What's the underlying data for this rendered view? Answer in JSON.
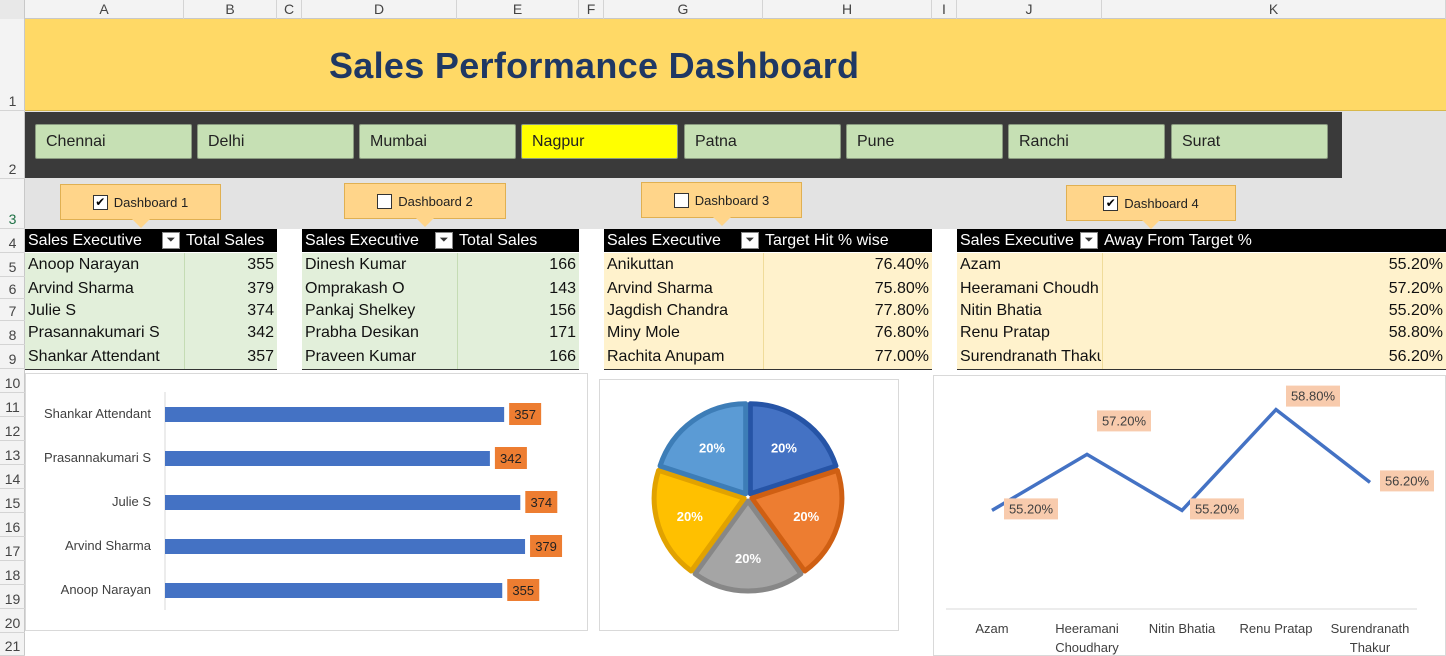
{
  "columns": [
    "A",
    "B",
    "C",
    "D",
    "E",
    "F",
    "G",
    "H",
    "I",
    "J",
    "K"
  ],
  "rows": [
    "1",
    "2",
    "3",
    "4",
    "5",
    "6",
    "7",
    "8",
    "9",
    "10",
    "11",
    "12",
    "13",
    "14",
    "15",
    "16",
    "17",
    "18",
    "19",
    "20",
    "21"
  ],
  "title": "Sales Performance Dashboard",
  "slicer": {
    "cities": [
      "Chennai",
      "Delhi",
      "Mumbai",
      "Nagpur",
      "Patna",
      "Pune",
      "Ranchi",
      "Surat"
    ],
    "selected": "Nagpur",
    "selected_color": "#ffff00",
    "item_color": "#c6e0b4"
  },
  "dashboards": [
    {
      "label": "Dashboard 1",
      "checked": true
    },
    {
      "label": "Dashboard 2",
      "checked": false
    },
    {
      "label": "Dashboard 3",
      "checked": false
    },
    {
      "label": "Dashboard 4",
      "checked": true
    }
  ],
  "tables": [
    {
      "headers": [
        "Sales Executive",
        "Total Sales"
      ],
      "rows": [
        [
          "Anoop Narayan",
          "355"
        ],
        [
          "Arvind Sharma",
          "379"
        ],
        [
          "Julie S",
          "374"
        ],
        [
          "Prasannakumari S",
          "342"
        ],
        [
          "Shankar Attendant",
          "357"
        ]
      ]
    },
    {
      "headers": [
        "Sales Executive",
        "Total Sales"
      ],
      "rows": [
        [
          "Dinesh Kumar",
          "166"
        ],
        [
          "Omprakash O",
          "143"
        ],
        [
          "Pankaj Shelkey",
          "156"
        ],
        [
          "Prabha Desikan",
          "171"
        ],
        [
          "Praveen Kumar",
          "166"
        ]
      ]
    },
    {
      "headers": [
        "Sales Executive",
        "Target Hit % wise"
      ],
      "rows": [
        [
          "Anikuttan",
          "76.40%"
        ],
        [
          "Arvind Sharma",
          "75.80%"
        ],
        [
          "Jagdish Chandra",
          "77.80%"
        ],
        [
          "Miny Mole",
          "76.80%"
        ],
        [
          "Rachita Anupam",
          "77.00%"
        ]
      ]
    },
    {
      "headers": [
        "Sales Executive",
        "Away From Target %"
      ],
      "rows": [
        [
          "Azam",
          "55.20%"
        ],
        [
          "Heeramani Choudh",
          "57.20%"
        ],
        [
          "Nitin Bhatia",
          "55.20%"
        ],
        [
          "Renu Pratap",
          "58.80%"
        ],
        [
          "Surendranath Thaku",
          "56.20%"
        ]
      ]
    }
  ],
  "colors": {
    "title_band": "#ffd966",
    "title_text": "#1f3864",
    "green_fill": "#e2efda",
    "yellow_fill": "#fff2cc",
    "bar_blue": "#4472c4",
    "label_orange": "#ed7d31",
    "line_label_fill": "#f8cbad"
  },
  "chart_data": [
    {
      "type": "bar",
      "categories": [
        "Shankar Attendant",
        "Prasannakumari S",
        "Julie S",
        "Arvind Sharma",
        "Anoop Narayan"
      ],
      "values": [
        357,
        342,
        374,
        379,
        355
      ],
      "xlim": [
        0,
        400
      ]
    },
    {
      "type": "pie",
      "labels": [
        "20%",
        "20%",
        "20%",
        "20%",
        "20%"
      ],
      "values": [
        20,
        20,
        20,
        20,
        20
      ],
      "colors": [
        "#4472c4",
        "#ed7d31",
        "#a5a5a5",
        "#ffc000",
        "#5b9bd5"
      ]
    },
    {
      "type": "line",
      "categories": [
        "Azam",
        "Heeramani Choudhary",
        "Nitin Bhatia",
        "Renu Pratap",
        "Surendranath Thakur"
      ],
      "values": [
        55.2,
        57.2,
        55.2,
        58.8,
        56.2
      ],
      "labels": [
        "55.20%",
        "57.20%",
        "55.20%",
        "58.80%",
        "56.20%"
      ],
      "ylim": [
        50,
        60
      ]
    }
  ]
}
